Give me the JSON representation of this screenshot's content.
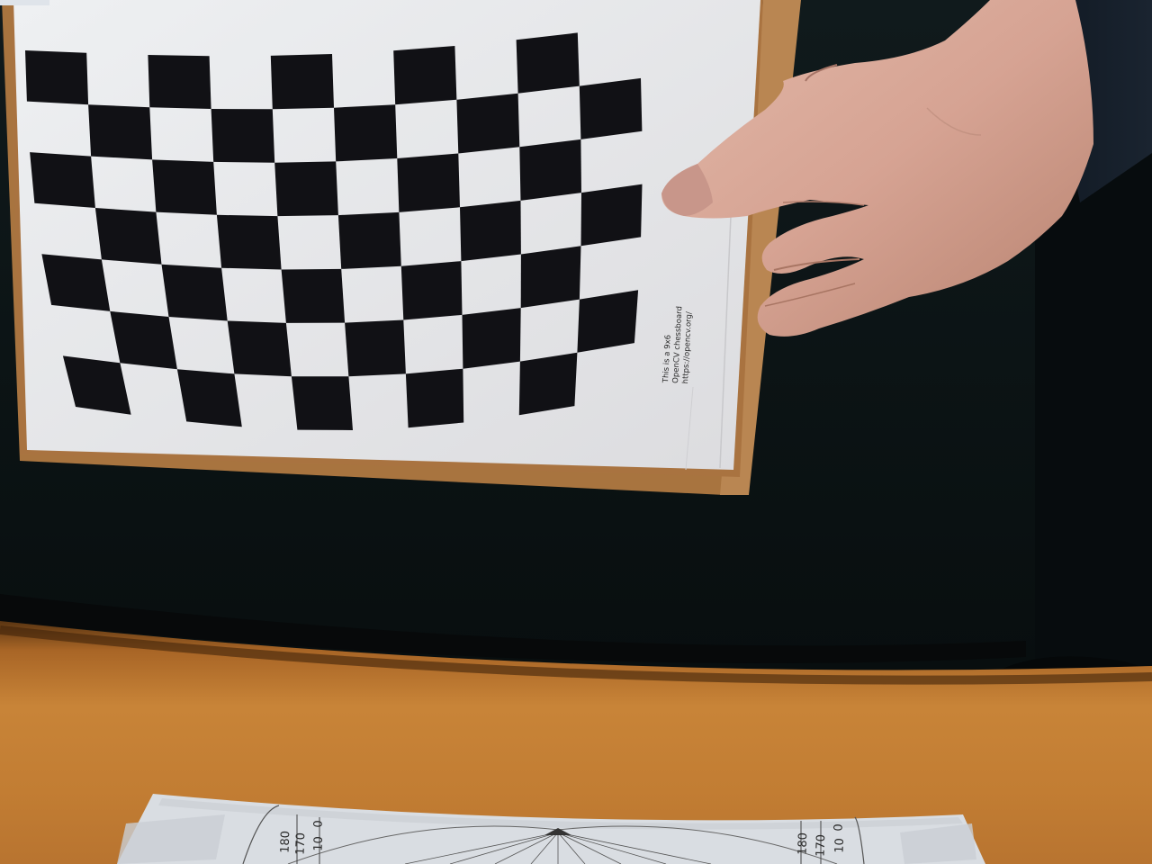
{
  "scene": {
    "description_colors": {
      "background": "#0b1314",
      "table": "#c17a32",
      "board_frame": "#b5804f",
      "board_paper": "#e6e6e8",
      "square": "#111115",
      "skin": "#d7a899"
    }
  },
  "chessboard": {
    "rows": 7,
    "cols": 10,
    "caption_lines": [
      "This is a 9x6",
      "OpenCV chessboard",
      "https://opencv.org/"
    ]
  },
  "protractor": {
    "left_labels": [
      "180",
      "170",
      "10",
      "0"
    ],
    "right_labels": [
      "180",
      "170",
      "10",
      "0"
    ]
  }
}
